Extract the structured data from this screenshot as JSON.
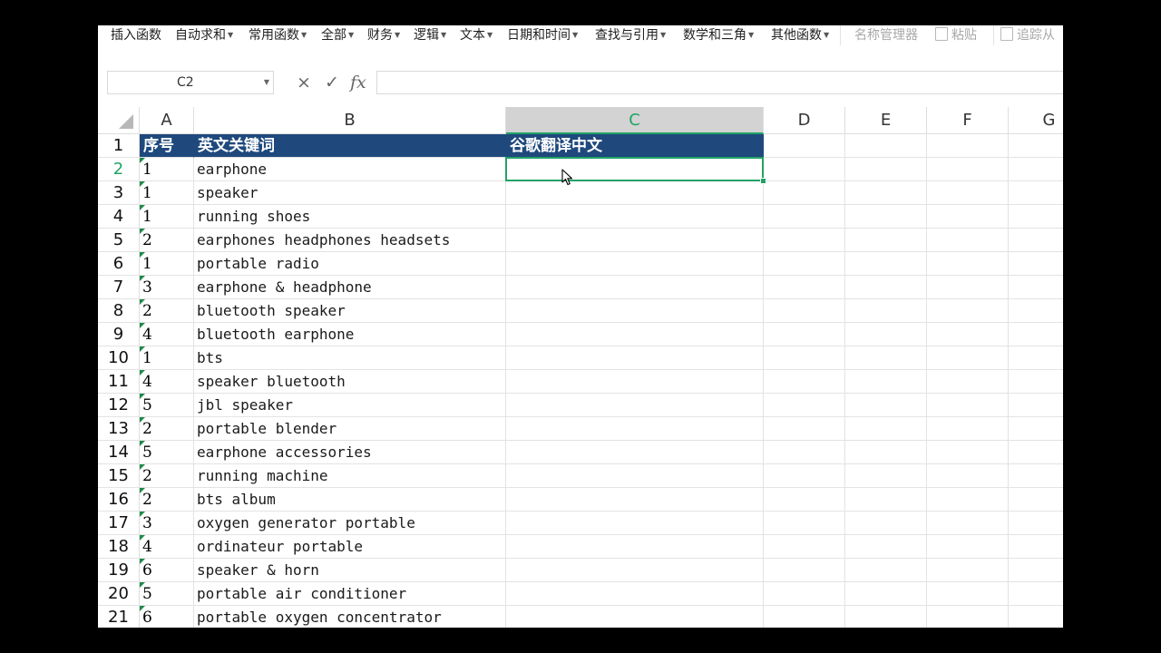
{
  "ribbon": {
    "items": [
      {
        "label": "插入函数",
        "caret": false,
        "disabled": false,
        "icon": ""
      },
      {
        "label": "自动求和",
        "caret": true,
        "disabled": false,
        "icon": ""
      },
      {
        "label": "常用函数",
        "caret": true,
        "disabled": false,
        "icon": ""
      },
      {
        "label": "全部",
        "caret": true,
        "disabled": false,
        "icon": ""
      },
      {
        "label": "财务",
        "caret": true,
        "disabled": false,
        "icon": ""
      },
      {
        "label": "逻辑",
        "caret": true,
        "disabled": false,
        "icon": ""
      },
      {
        "label": "文本",
        "caret": true,
        "disabled": false,
        "icon": ""
      },
      {
        "label": "日期和时间",
        "caret": true,
        "disabled": false,
        "icon": ""
      },
      {
        "label": "查找与引用",
        "caret": true,
        "disabled": false,
        "icon": ""
      },
      {
        "label": "数学和三角",
        "caret": true,
        "disabled": false,
        "icon": ""
      },
      {
        "label": "其他函数",
        "caret": true,
        "disabled": false,
        "icon": ""
      },
      {
        "label": "名称管理器",
        "caret": false,
        "disabled": true,
        "icon": ""
      },
      {
        "label": "粘贴",
        "caret": false,
        "disabled": true,
        "icon": "paste-icon"
      },
      {
        "label": "追踪从",
        "caret": false,
        "disabled": true,
        "icon": "trace-precedents-icon"
      }
    ]
  },
  "formula_bar": {
    "name_box": "C2",
    "cancel_symbol": "×",
    "confirm_symbol": "✓",
    "fx_label": "fx",
    "formula": ""
  },
  "columns": [
    "A",
    "B",
    "C",
    "D",
    "E",
    "F",
    "G"
  ],
  "selected_column": "C",
  "selected_row": 2,
  "header_row": {
    "a": "序号",
    "b": "英文关键词",
    "c": "谷歌翻译中文"
  },
  "rows": [
    {
      "n": 2,
      "a": "1",
      "b": "earphone"
    },
    {
      "n": 3,
      "a": "1",
      "b": "speaker"
    },
    {
      "n": 4,
      "a": "1",
      "b": "running shoes"
    },
    {
      "n": 5,
      "a": "2",
      "b": "earphones headphones headsets"
    },
    {
      "n": 6,
      "a": "1",
      "b": "portable radio"
    },
    {
      "n": 7,
      "a": "3",
      "b": "earphone & headphone"
    },
    {
      "n": 8,
      "a": "2",
      "b": "bluetooth speaker"
    },
    {
      "n": 9,
      "a": "4",
      "b": "bluetooth earphone"
    },
    {
      "n": 10,
      "a": "1",
      "b": "bts"
    },
    {
      "n": 11,
      "a": "4",
      "b": "speaker bluetooth"
    },
    {
      "n": 12,
      "a": "5",
      "b": "jbl speaker"
    },
    {
      "n": 13,
      "a": "2",
      "b": "portable blender"
    },
    {
      "n": 14,
      "a": "5",
      "b": "earphone accessories"
    },
    {
      "n": 15,
      "a": "2",
      "b": "running machine"
    },
    {
      "n": 16,
      "a": "2",
      "b": "bts album"
    },
    {
      "n": 17,
      "a": "3",
      "b": "oxygen generator portable"
    },
    {
      "n": 18,
      "a": "4",
      "b": "ordinateur portable"
    },
    {
      "n": 19,
      "a": "6",
      "b": "speaker & horn"
    },
    {
      "n": 20,
      "a": "5",
      "b": "portable air conditioner"
    },
    {
      "n": 21,
      "a": "6",
      "b": "portable oxygen concentrator"
    }
  ],
  "colors": {
    "header_fill": "#1f497d",
    "selection_green": "#21a366",
    "error_triangle": "#1e8b4b"
  }
}
